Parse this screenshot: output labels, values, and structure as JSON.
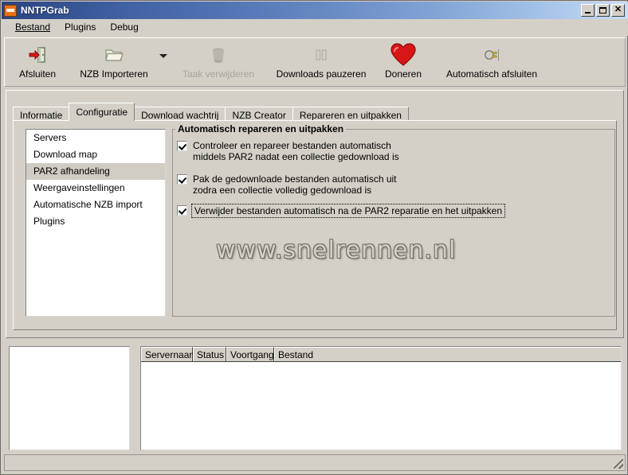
{
  "window": {
    "title": "NNTPGrab",
    "icon": "app-icon",
    "buttons": {
      "minimize": "Minimize",
      "maximize": "Maximize",
      "close": "Close"
    }
  },
  "menu": {
    "items": [
      {
        "label": "Bestand"
      },
      {
        "label": "Plugins"
      },
      {
        "label": "Debug"
      }
    ]
  },
  "toolbar": {
    "buttons": [
      {
        "label": "Afsluiten",
        "icon": "exit-icon",
        "enabled": true
      },
      {
        "label": "NZB Importeren",
        "icon": "folder-open-icon",
        "enabled": true
      },
      {
        "label": "Taak verwijderen",
        "icon": "trash-icon",
        "enabled": false
      },
      {
        "label": "Downloads pauzeren",
        "icon": "pause-icon",
        "enabled": true
      },
      {
        "label": "Doneren",
        "icon": "heart-icon",
        "enabled": true
      },
      {
        "label": "Automatisch afsluiten",
        "icon": "power-plug-icon",
        "enabled": true
      }
    ]
  },
  "tabs": [
    {
      "label": "Informatie",
      "active": false
    },
    {
      "label": "Configuratie",
      "active": true
    },
    {
      "label": "Download wachtrij",
      "active": false
    },
    {
      "label": "NZB Creator",
      "active": false
    },
    {
      "label": "Repareren en uitpakken",
      "active": false
    }
  ],
  "categories": [
    {
      "label": "Servers",
      "selected": false
    },
    {
      "label": "Download map",
      "selected": false
    },
    {
      "label": "PAR2 afhandeling",
      "selected": true
    },
    {
      "label": "Weergaveinstellingen",
      "selected": false
    },
    {
      "label": "Automatische NZB import",
      "selected": false
    },
    {
      "label": "Plugins",
      "selected": false
    }
  ],
  "groupbox": {
    "title": "Automatisch repareren en uitpakken",
    "checkboxes": [
      {
        "label": "Controleer en repareer bestanden automatisch\nmiddels PAR2 nadat een collectie gedownload is",
        "checked": true,
        "focused": false
      },
      {
        "label": "Pak de gedownloade bestanden automatisch uit\nzodra een collectie volledig gedownload is",
        "checked": true,
        "focused": false
      },
      {
        "label": "Verwijder bestanden automatisch na de PAR2 reparatie en het uitpakken",
        "checked": true,
        "focused": true
      }
    ]
  },
  "watermark": "www.snelrennen.nl",
  "connections": {
    "columns": [
      "Servernaam",
      "Status",
      "Voortgang",
      "Bestand"
    ],
    "rows": []
  },
  "log": {
    "lines": []
  },
  "statusbar": {
    "text": ""
  },
  "colors": {
    "window_face": "#d4d0c8",
    "title_gradient_start": "#2a4480",
    "title_gradient_end": "#c9ddf4",
    "selection": "#d0ccc4",
    "accent_orange": "#e8701a",
    "heart_red": "#d81616",
    "disabled_text": "#a7a39c"
  }
}
